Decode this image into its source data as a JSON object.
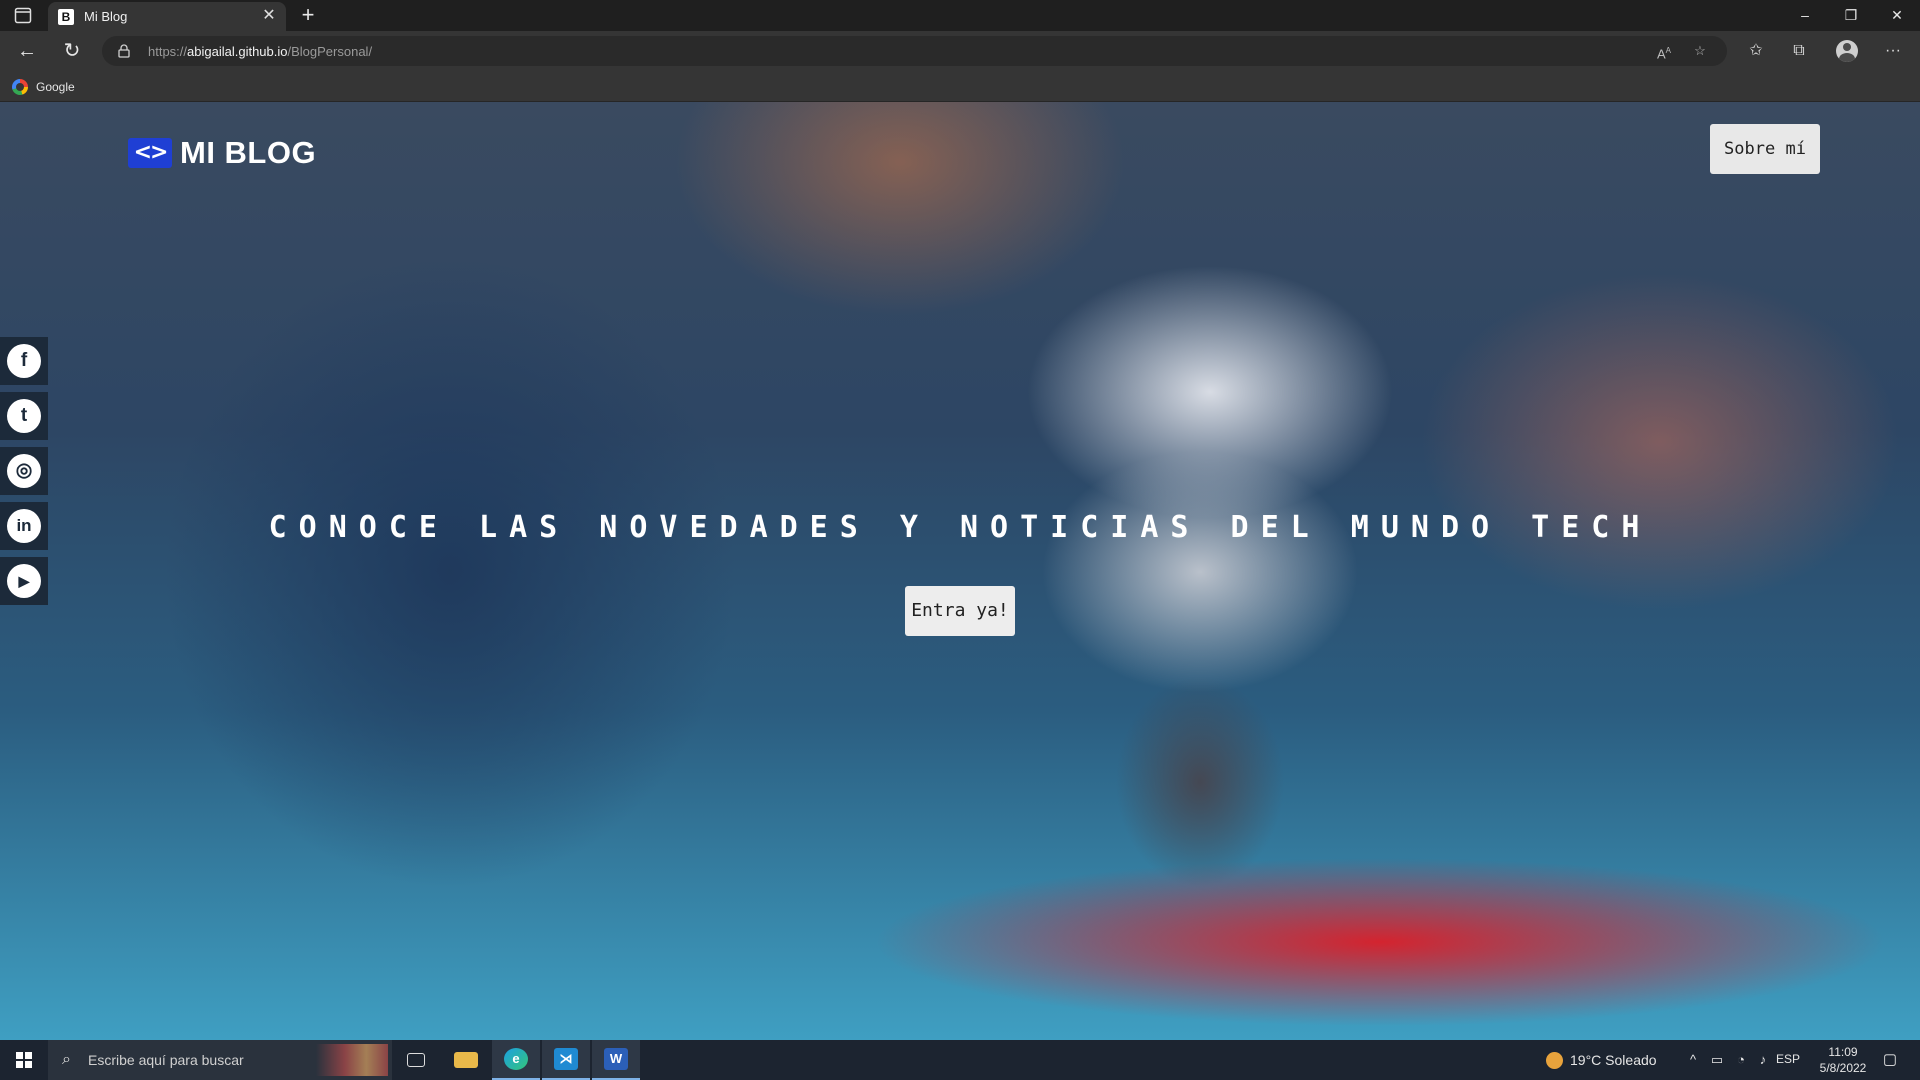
{
  "browser": {
    "tab_title": "Mi Blog",
    "tab_favicon_letter": "B",
    "url_prefix": "https://",
    "url_domain": "abigailal.github.io",
    "url_path": "/BlogPersonal/",
    "bookmark_google": "Google"
  },
  "page": {
    "logo_mark": "<>",
    "logo_text": "MI BLOG",
    "sobre_mi": "Sobre mí",
    "hero_title": "CONOCE LAS NOVEDADES Y NOTICIAS DEL MUNDO TECH",
    "entra_ya": "Entra ya!",
    "social": [
      {
        "name": "facebook",
        "glyph": "f"
      },
      {
        "name": "tumblr",
        "glyph": "t"
      },
      {
        "name": "instagram",
        "glyph": "◎"
      },
      {
        "name": "linkedin",
        "glyph": "in"
      },
      {
        "name": "youtube",
        "glyph": "▶"
      }
    ],
    "colors": {
      "logo_blue": "#1f3fd4",
      "social_bg": "#1c2a3a",
      "filament_red": "#dc1e28"
    }
  },
  "taskbar": {
    "search_placeholder": "Escribe aquí para buscar",
    "weather": "19°C  Soleado",
    "language": "ESP",
    "time": "11:09",
    "date": "5/8/2022"
  }
}
